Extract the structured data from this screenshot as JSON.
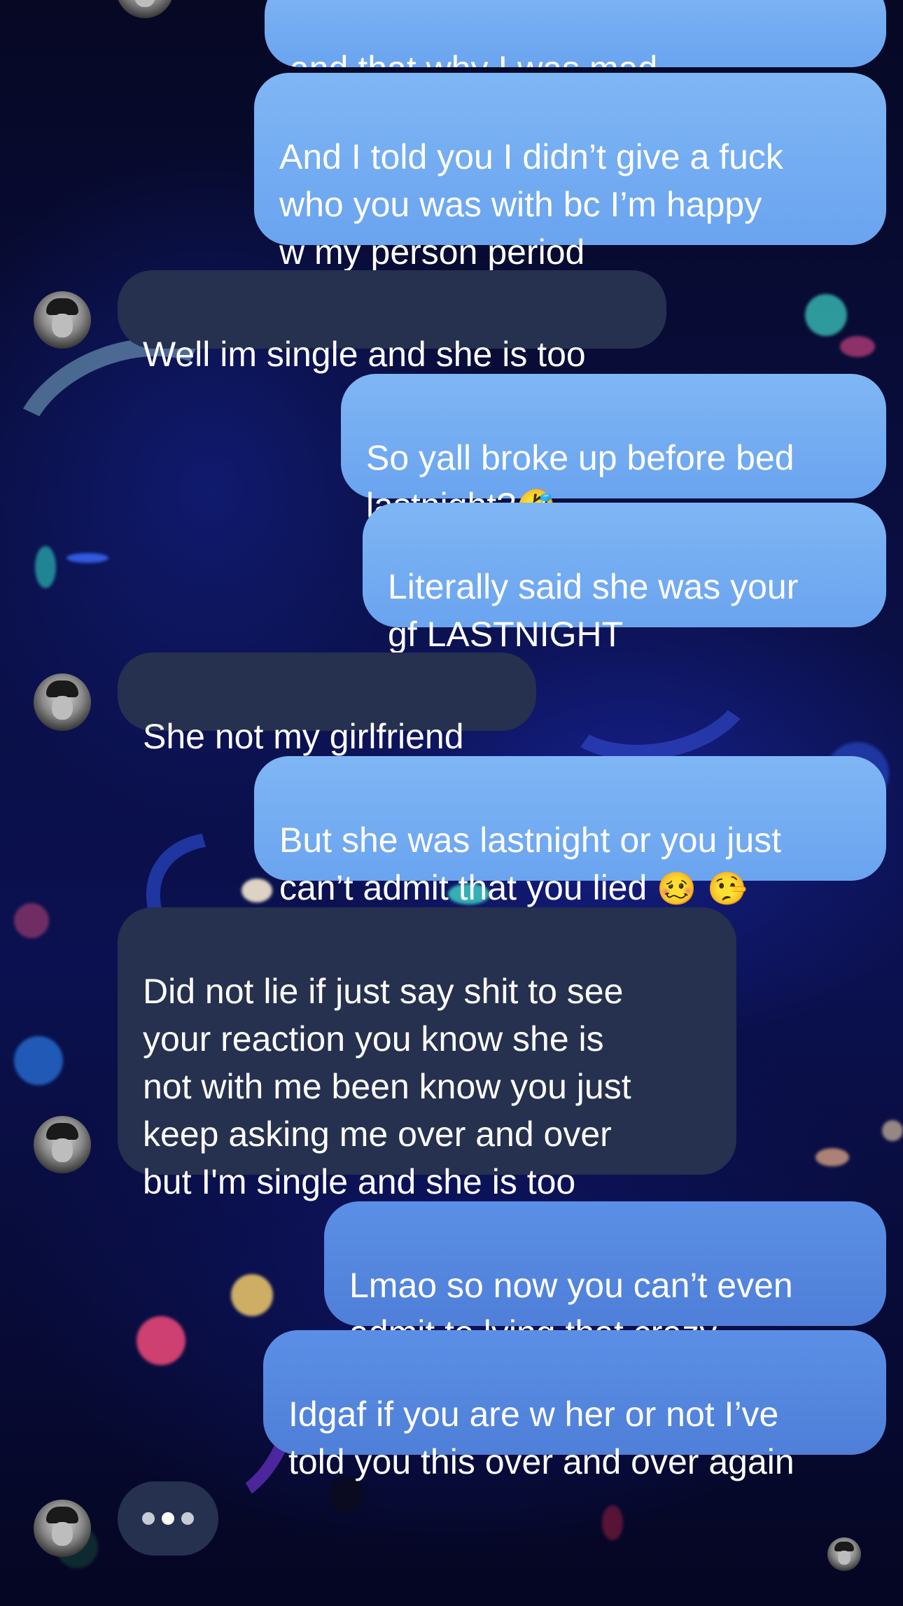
{
  "messages": [
    {
      "id": "m0",
      "side": "sent",
      "text": "and that why I was mad"
    },
    {
      "id": "m1",
      "side": "sent",
      "text": "And I told you I didn’t give a fuck\nwho you was with bc I’m happy\nw my person period"
    },
    {
      "id": "m2",
      "side": "received",
      "text": "Well im single and she is too"
    },
    {
      "id": "m3",
      "side": "sent",
      "text": "So yall broke up before bed\nlastnight?",
      "emoji": "🤣"
    },
    {
      "id": "m4",
      "side": "sent",
      "text": "Literally said she was your\ngf LASTNIGHT"
    },
    {
      "id": "m5",
      "side": "received",
      "text": "She not my girlfriend"
    },
    {
      "id": "m6",
      "side": "sent",
      "text": "But she was lastnight or you just\ncan’t admit that you lied ",
      "emoji": "🥴 🤥"
    },
    {
      "id": "m7",
      "side": "received",
      "text": "Did not lie if just say shit to see\nyour reaction you know she is\nnot with me been know you just\nkeep asking me over and over\nbut I'm single and she is too"
    },
    {
      "id": "m8",
      "side": "sent",
      "text": "Lmao so now you can’t even\nadmit to lying that crazy"
    },
    {
      "id": "m9",
      "side": "sent",
      "text": "Idgaf if you are w her or not I’ve\ntold you this over and over again"
    }
  ],
  "typing_indicator": {
    "label": "•••"
  },
  "icons": {
    "contact_avatar": "person-avatar-icon",
    "read_receipt": "read-receipt-avatar-icon",
    "typing": "typing-dots-icon"
  },
  "colors": {
    "sent_bubble": "#74aef3",
    "sent_bubble_deep": "#5587dd",
    "received_bubble": "#26304f",
    "background": "#0a0f45"
  }
}
